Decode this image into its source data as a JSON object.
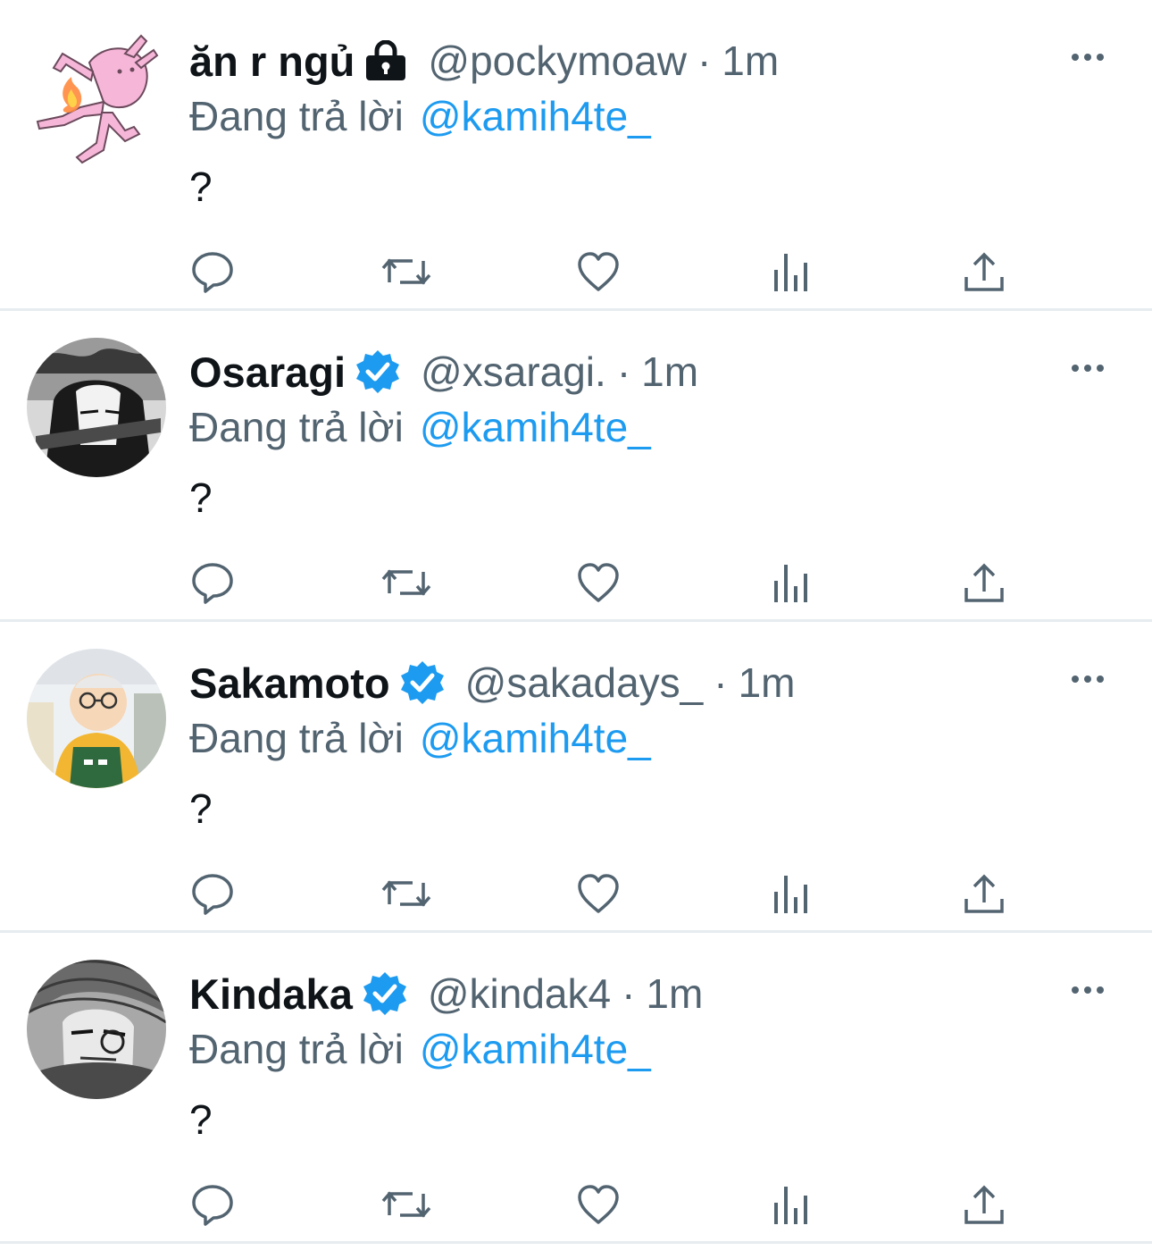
{
  "colors": {
    "text_primary": "#0f1419",
    "text_secondary": "#536471",
    "link_blue": "#1d9bf0",
    "verified_blue": "#1d9bf0",
    "divider": "#e6ecf0"
  },
  "tweets": [
    {
      "display_name": "ăn r ngủ",
      "badge": "lock-icon",
      "handle": "@pockymoaw",
      "separator": "·",
      "time": "1m",
      "reply_prefix": "Đang trả lời",
      "reply_to": "@kamih4te_",
      "text": "?"
    },
    {
      "display_name": "Osaragi",
      "badge": "verified-icon",
      "handle": "@xsaragi.",
      "separator": "·",
      "time": "1m",
      "reply_prefix": "Đang trả lời",
      "reply_to": "@kamih4te_",
      "text": "?"
    },
    {
      "display_name": "Sakamoto",
      "badge": "verified-icon",
      "handle": "@sakadays_",
      "separator": "·",
      "time": "1m",
      "reply_prefix": "Đang trả lời",
      "reply_to": "@kamih4te_",
      "text": "?"
    },
    {
      "display_name": "Kindaka",
      "badge": "verified-icon",
      "handle": "@kindak4",
      "separator": "·",
      "time": "1m",
      "reply_prefix": "Đang trả lời",
      "reply_to": "@kamih4te_",
      "text": "?"
    }
  ],
  "action_icons": [
    "reply-icon",
    "retweet-icon",
    "like-icon",
    "views-icon",
    "share-icon"
  ]
}
